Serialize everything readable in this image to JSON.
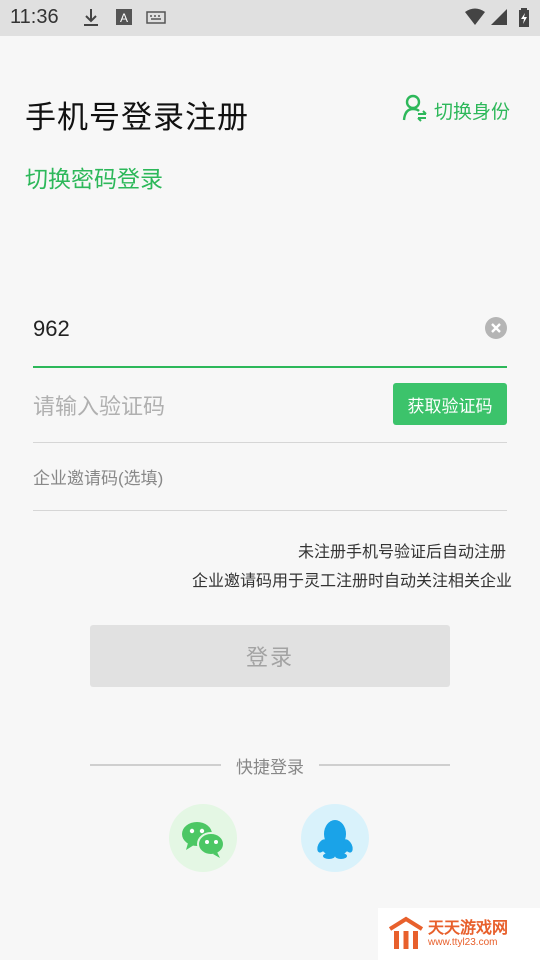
{
  "status_bar": {
    "time": "11:36",
    "icons": [
      "download-icon",
      "font-a-icon",
      "keyboard-icon",
      "wifi-icon",
      "cell-signal-icon",
      "battery-icon"
    ]
  },
  "header": {
    "title": "手机号登录注册",
    "switch_role_label": "切换身份",
    "switch_role_icon": "user-switch-icon"
  },
  "password_login_link": "切换密码登录",
  "form": {
    "phone_value": "962",
    "code_placeholder": "请输入验证码",
    "get_code_label": "获取验证码",
    "invite_placeholder": "企业邀请码(选填)"
  },
  "hints": {
    "line1": "未注册手机号验证后自动注册",
    "line2": "企业邀请码用于灵工注册时自动关注相关企业"
  },
  "login_button": "登录",
  "quick_login": {
    "label": "快捷登录",
    "options": [
      "wechat-icon",
      "qq-icon"
    ]
  },
  "watermark": {
    "title": "天天游戏网",
    "url": "www.ttyl23.com"
  },
  "colors": {
    "accent_green": "#2db85a",
    "button_green": "#3cc36b",
    "disabled_button": "#e1e1e1",
    "watermark_orange": "#e8602c"
  }
}
